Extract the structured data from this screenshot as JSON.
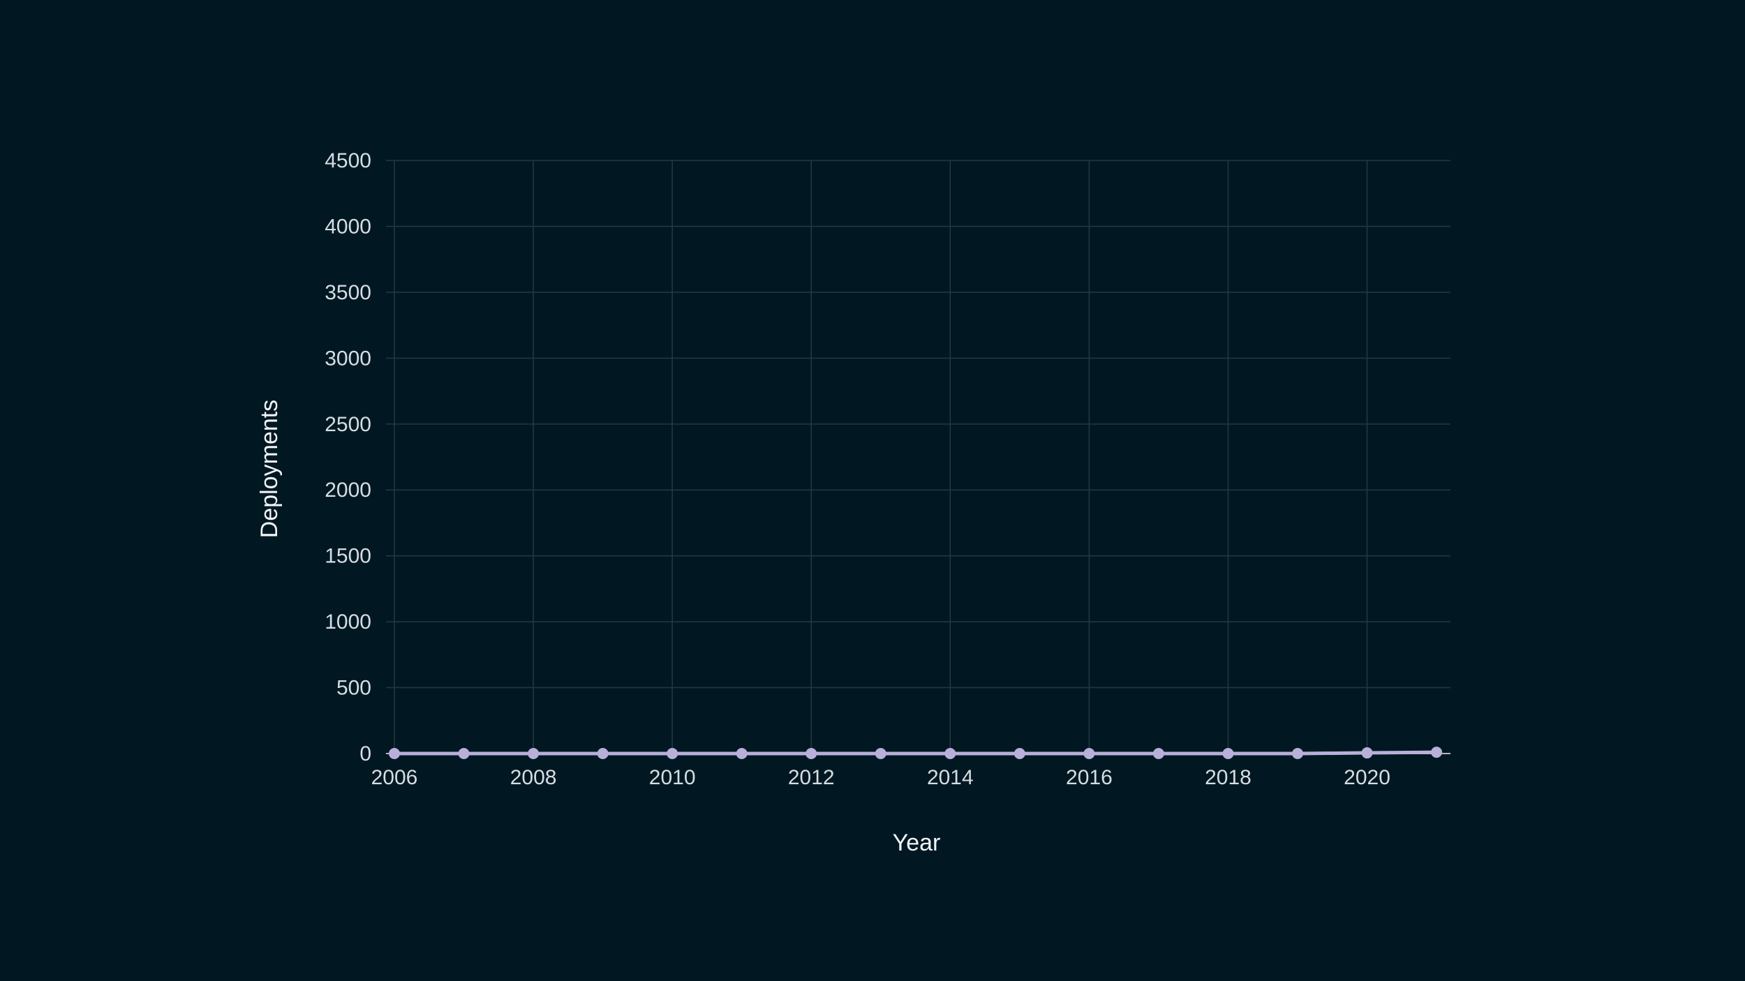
{
  "chart_data": {
    "type": "line",
    "title": "",
    "xlabel": "Year",
    "ylabel": "Deployments",
    "x": [
      2006,
      2007,
      2008,
      2009,
      2010,
      2011,
      2012,
      2013,
      2014,
      2015,
      2016,
      2017,
      2018,
      2019,
      2020,
      2021
    ],
    "series": [
      {
        "values": [
          0,
          0,
          0,
          0,
          0,
          0,
          0,
          0,
          0,
          0,
          0,
          0,
          0,
          0,
          5,
          10
        ],
        "color": "#b9b0da"
      }
    ],
    "xlim": [
      2006,
      2021.2
    ],
    "ylim": [
      0,
      4500
    ],
    "x_ticks": [
      2006,
      2008,
      2010,
      2012,
      2014,
      2016,
      2018,
      2020
    ],
    "y_ticks": [
      0,
      500,
      1000,
      1500,
      2000,
      2500,
      3000,
      3500,
      4000,
      4500
    ],
    "grid": true,
    "legend": "none",
    "colors": {
      "background": "#011823",
      "grid": "#243845",
      "tick_text": "#d6dde2",
      "title_text": "#f2f5f7"
    }
  }
}
